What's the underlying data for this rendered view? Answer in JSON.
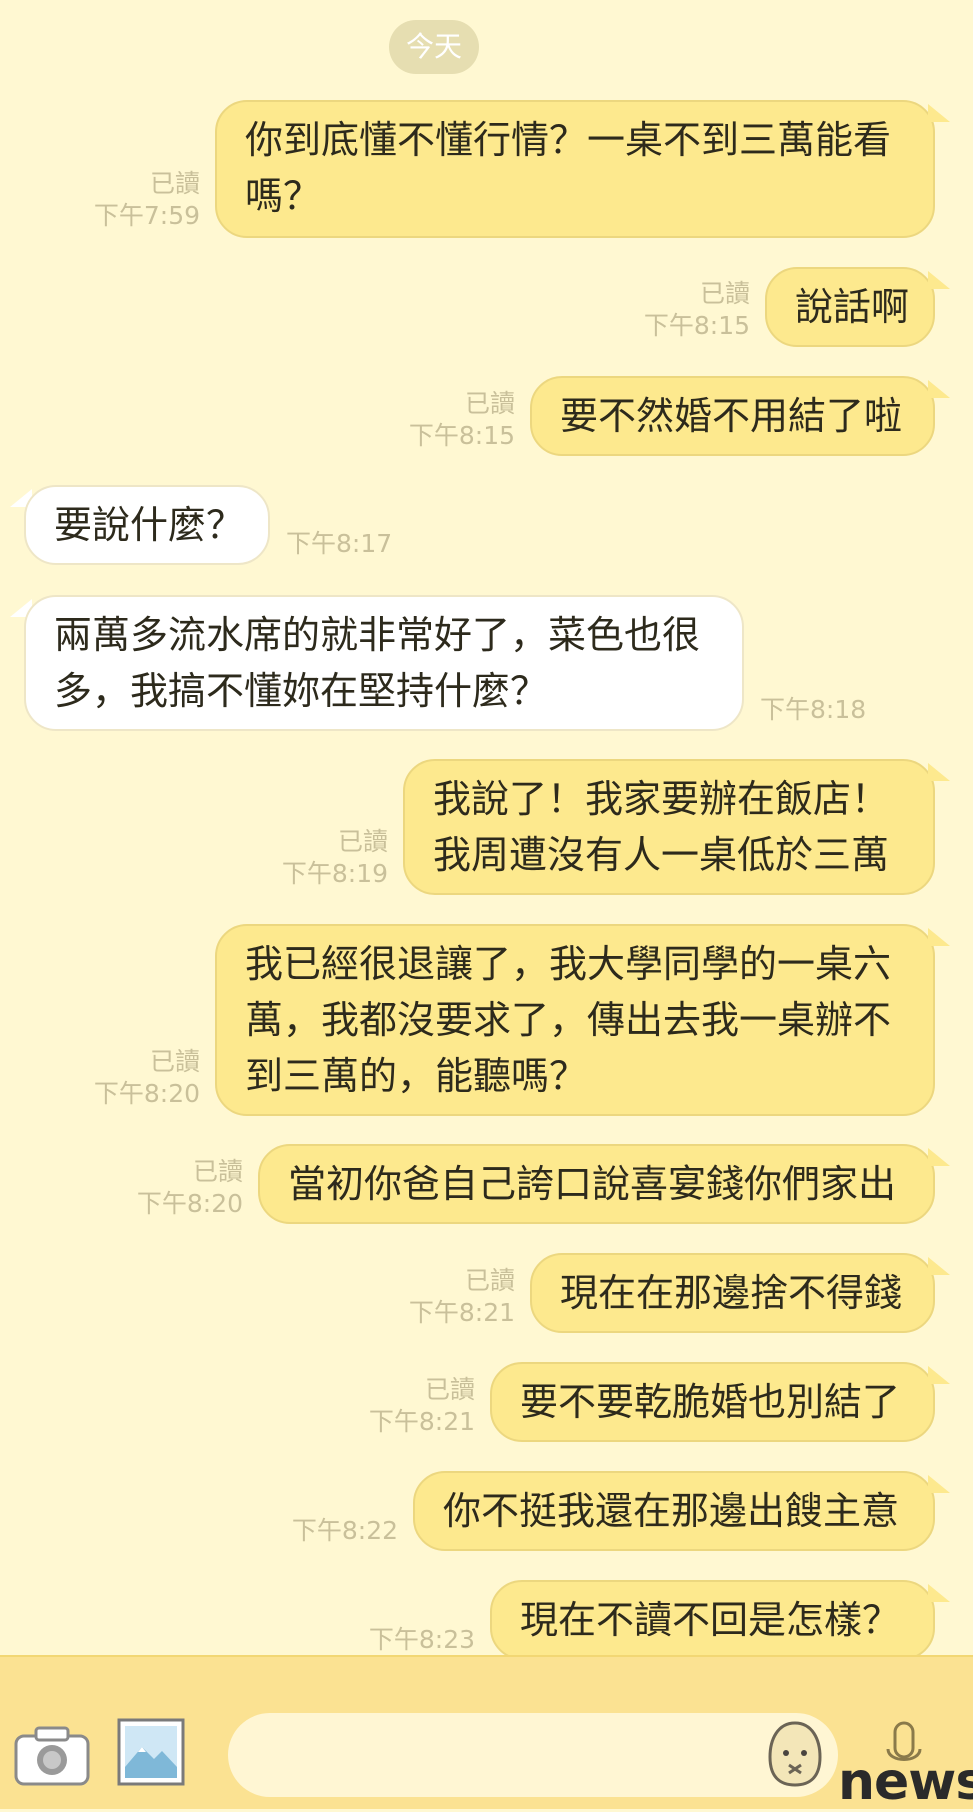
{
  "date_separator": "今天",
  "messages": [
    {
      "side": "out",
      "lines": [
        "你到底懂不懂行情？一桌不到三萬能看",
        "嗎？"
      ],
      "read": "已讀",
      "time": "下午7:59"
    },
    {
      "side": "out",
      "lines": [
        "說話啊"
      ],
      "read": "已讀",
      "time": "下午8:15"
    },
    {
      "side": "out",
      "lines": [
        "要不然婚不用結了啦"
      ],
      "read": "已讀",
      "time": "下午8:15"
    },
    {
      "side": "in",
      "lines": [
        "要說什麼？"
      ],
      "time": "下午8:17"
    },
    {
      "side": "in",
      "lines": [
        "兩萬多流水席的就非常好了，菜色也很",
        "多，我搞不懂妳在堅持什麼？"
      ],
      "time": "下午8:18"
    },
    {
      "side": "out",
      "lines": [
        "我說了！我家要辦在飯店！",
        "我周遭沒有人一桌低於三萬"
      ],
      "read": "已讀",
      "time": "下午8:19"
    },
    {
      "side": "out",
      "lines": [
        "我已經很退讓了，我大學同學的一桌六",
        "萬，我都沒要求了，傳出去我一桌辦不",
        "到三萬的，能聽嗎？"
      ],
      "read": "已讀",
      "time": "下午8:20"
    },
    {
      "side": "out",
      "lines": [
        "當初你爸自己誇口說喜宴錢你們家出"
      ],
      "read": "已讀",
      "time": "下午8:20"
    },
    {
      "side": "out",
      "lines": [
        "現在在那邊捨不得錢"
      ],
      "read": "已讀",
      "time": "下午8:21"
    },
    {
      "side": "out",
      "lines": [
        "要不要乾脆婚也別結了"
      ],
      "read": "已讀",
      "time": "下午8:21"
    },
    {
      "side": "out",
      "lines": [
        "你不挺我還在那邊出餿主意"
      ],
      "time": "下午8:22"
    },
    {
      "side": "out",
      "lines": [
        "現在不讀不回是怎樣？"
      ],
      "time": "下午8:23"
    }
  ],
  "input_bar": {
    "camera_icon": "camera-icon",
    "gallery_icon": "image-icon",
    "sticker_icon": "sticker-icon",
    "mic_icon": "microphone-icon"
  },
  "watermark": "news",
  "colors": {
    "background": "#fff8d2",
    "outgoing_bubble": "#fde98e",
    "incoming_bubble": "#ffffff",
    "input_bar": "#fbe292",
    "meta_text": "#c9c09a"
  }
}
